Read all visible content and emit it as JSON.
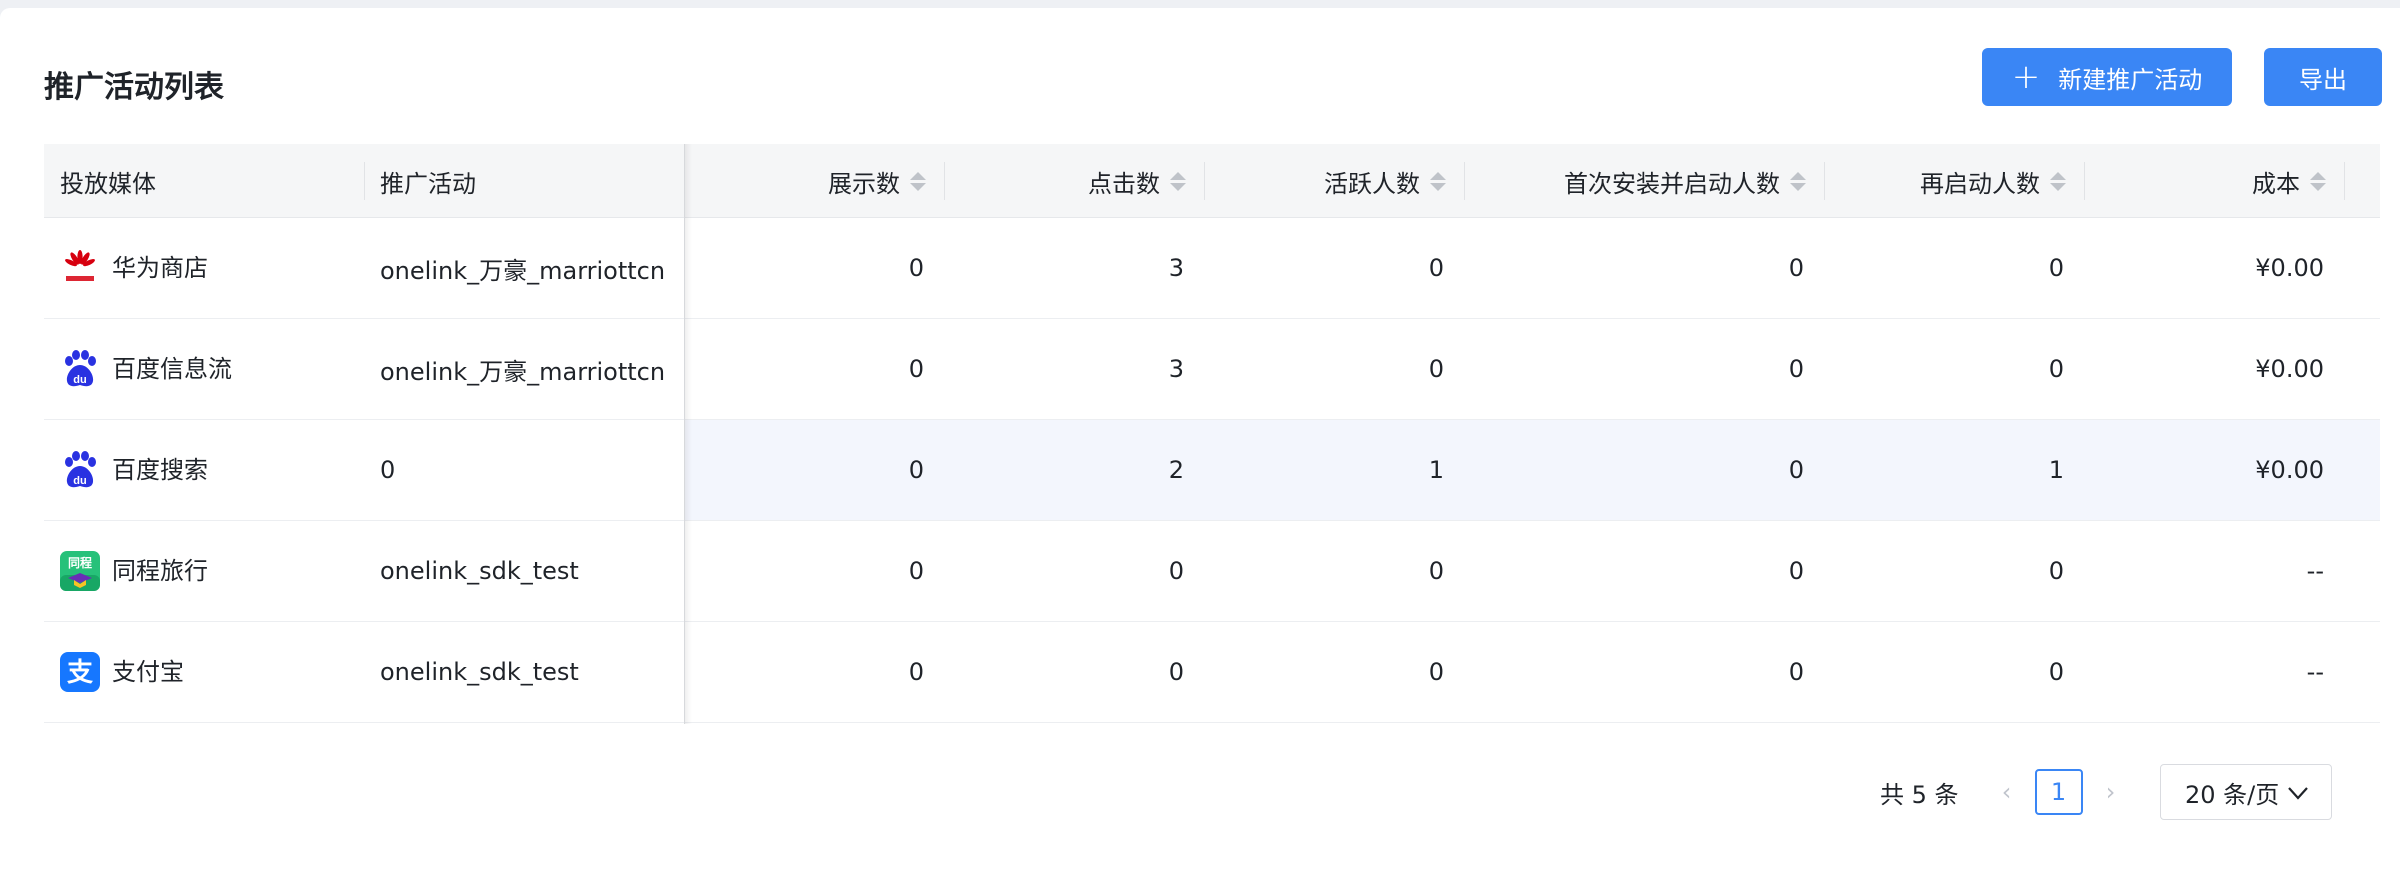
{
  "page_title": "推广活动列表",
  "actions": {
    "new_label": "新建推广活动",
    "new_icon": "plus-icon",
    "export_label": "导出"
  },
  "columns": [
    "投放媒体",
    "推广活动",
    "展示数",
    "点击数",
    "活跃人数",
    "首次安装并启动人数",
    "再启动人数",
    "成本"
  ],
  "rows": [
    {
      "media": "华为商店",
      "icon": "huawei-logo",
      "campaign": "onelink_万豪_marriottcn",
      "impressions": "0",
      "clicks": "3",
      "active": "0",
      "first_install": "0",
      "relaunch": "0",
      "cost": "¥0.00"
    },
    {
      "media": "百度信息流",
      "icon": "baidu-logo",
      "campaign": "onelink_万豪_marriottcn",
      "impressions": "0",
      "clicks": "3",
      "active": "0",
      "first_install": "0",
      "relaunch": "0",
      "cost": "¥0.00"
    },
    {
      "media": "百度搜索",
      "icon": "baidu-logo",
      "campaign": "0",
      "impressions": "0",
      "clicks": "2",
      "active": "1",
      "first_install": "0",
      "relaunch": "1",
      "cost": "¥0.00"
    },
    {
      "media": "同程旅行",
      "icon": "tongcheng-logo",
      "campaign": "onelink_sdk_test",
      "impressions": "0",
      "clicks": "0",
      "active": "0",
      "first_install": "0",
      "relaunch": "0",
      "cost": "--"
    },
    {
      "media": "支付宝",
      "icon": "alipay-logo",
      "campaign": "onelink_sdk_test",
      "impressions": "0",
      "clicks": "0",
      "active": "0",
      "first_install": "0",
      "relaunch": "0",
      "cost": "--"
    }
  ],
  "pagination": {
    "total_text": "共 5 条",
    "current_page": "1",
    "page_size": "20 条/页"
  },
  "colors": {
    "primary": "#3a86f5",
    "header_bg": "#f5f6f7",
    "highlight_row": "#f3f6fd"
  }
}
